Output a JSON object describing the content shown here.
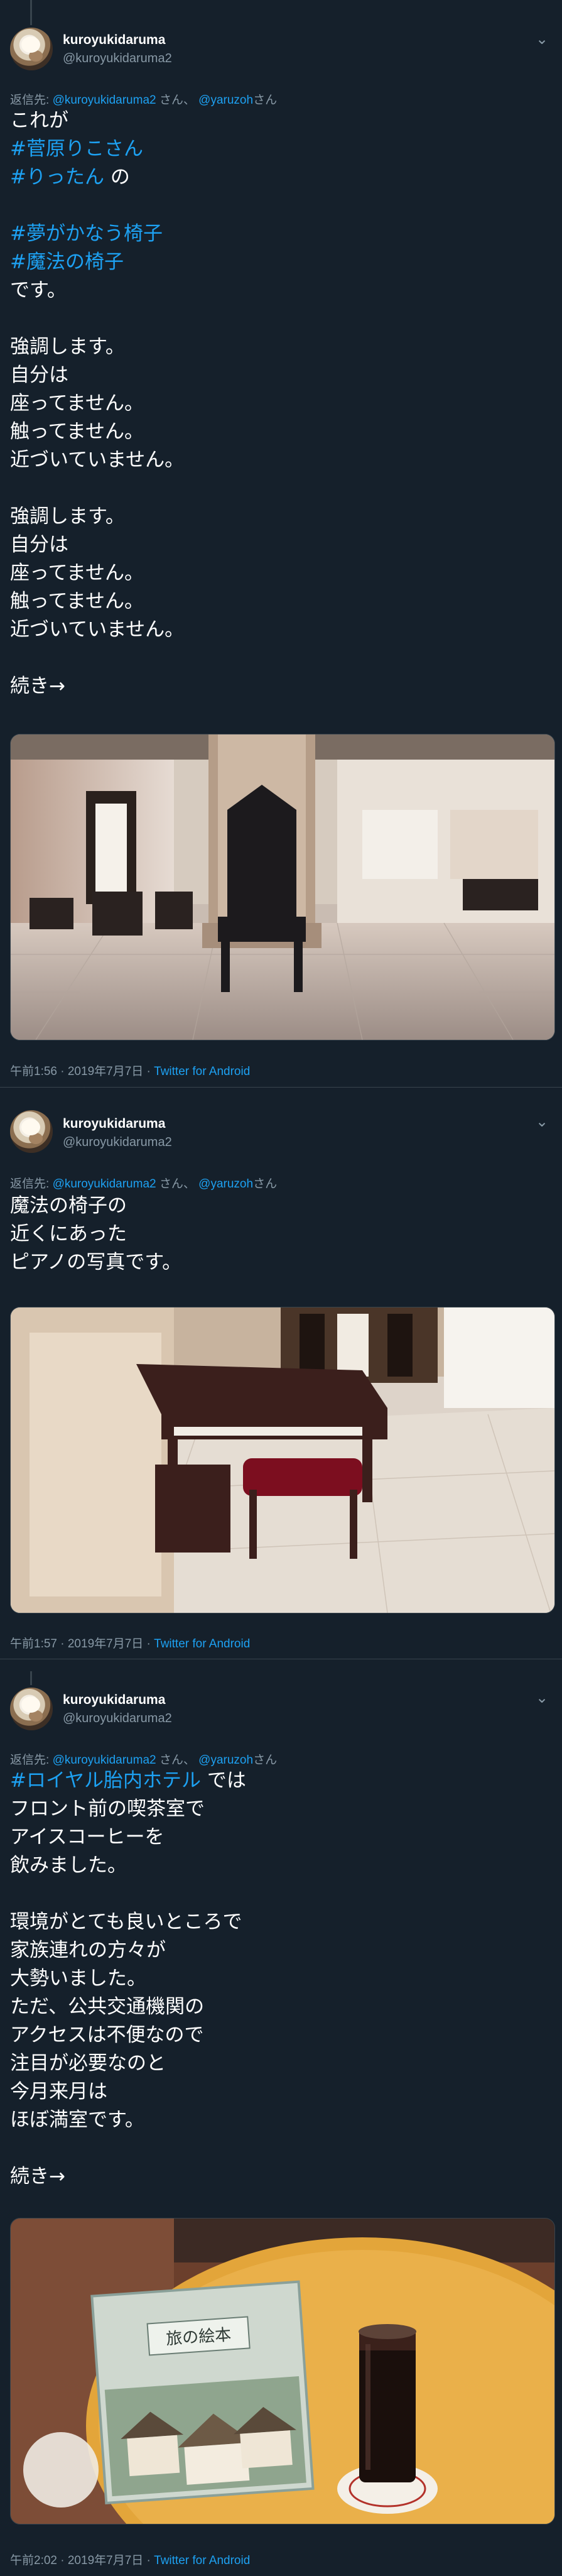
{
  "tweets": [
    {
      "display_name": "kuroyukidaruma",
      "handle": "@kuroyukidaruma2",
      "reply_prefix": "返信先:",
      "reply_mention_1": "@kuroyukidaruma2",
      "reply_suffix_1": "さん、",
      "reply_mention_2": "@yaruzoh",
      "reply_suffix_2": "さん",
      "lines": [
        {
          "parts": [
            {
              "text": "これが",
              "tag": false
            }
          ]
        },
        {
          "parts": [
            {
              "text": "#菅原りこさん",
              "tag": true
            }
          ]
        },
        {
          "parts": [
            {
              "text": "#りったん",
              "tag": true
            },
            {
              "text": " の",
              "tag": false
            }
          ]
        },
        {
          "parts": []
        },
        {
          "parts": [
            {
              "text": "#夢がかなう椅子",
              "tag": true
            }
          ]
        },
        {
          "parts": [
            {
              "text": "#魔法の椅子",
              "tag": true
            }
          ]
        },
        {
          "parts": [
            {
              "text": "です。",
              "tag": false
            }
          ]
        },
        {
          "parts": []
        },
        {
          "parts": [
            {
              "text": "強調します。",
              "tag": false
            }
          ]
        },
        {
          "parts": [
            {
              "text": "自分は",
              "tag": false
            }
          ]
        },
        {
          "parts": [
            {
              "text": "座ってません。",
              "tag": false
            }
          ]
        },
        {
          "parts": [
            {
              "text": "触ってません。",
              "tag": false
            }
          ]
        },
        {
          "parts": [
            {
              "text": "近づいていません。",
              "tag": false
            }
          ]
        },
        {
          "parts": []
        },
        {
          "parts": [
            {
              "text": "強調します。",
              "tag": false
            }
          ]
        },
        {
          "parts": [
            {
              "text": "自分は",
              "tag": false
            }
          ]
        },
        {
          "parts": [
            {
              "text": "座ってません。",
              "tag": false
            }
          ]
        },
        {
          "parts": [
            {
              "text": "触ってません。",
              "tag": false
            }
          ]
        },
        {
          "parts": [
            {
              "text": "近づいていません。",
              "tag": false
            }
          ]
        },
        {
          "parts": []
        },
        {
          "parts": [
            {
              "text": "続き→",
              "tag": false
            }
          ]
        }
      ],
      "timestamp": "午前1:56 · 2019年7月7日 · ",
      "source": "Twitter for Android"
    },
    {
      "display_name": "kuroyukidaruma",
      "handle": "@kuroyukidaruma2",
      "reply_prefix": "返信先:",
      "reply_mention_1": "@kuroyukidaruma2",
      "reply_suffix_1": "さん、",
      "reply_mention_2": "@yaruzoh",
      "reply_suffix_2": "さん",
      "lines": [
        {
          "parts": [
            {
              "text": "魔法の椅子の",
              "tag": false
            }
          ]
        },
        {
          "parts": [
            {
              "text": "近くにあった",
              "tag": false
            }
          ]
        },
        {
          "parts": [
            {
              "text": "ピアノの写真です。",
              "tag": false
            }
          ]
        }
      ],
      "timestamp": "午前1:57 · 2019年7月7日 · ",
      "source": "Twitter for Android"
    },
    {
      "display_name": "kuroyukidaruma",
      "handle": "@kuroyukidaruma2",
      "reply_prefix": "返信先:",
      "reply_mention_1": "@kuroyukidaruma2",
      "reply_suffix_1": "さん、",
      "reply_mention_2": "@yaruzoh",
      "reply_suffix_2": "さん",
      "lines": [
        {
          "parts": [
            {
              "text": "#ロイヤル胎内ホテル",
              "tag": true
            },
            {
              "text": " では",
              "tag": false
            }
          ]
        },
        {
          "parts": [
            {
              "text": "フロント前の喫茶室で",
              "tag": false
            }
          ]
        },
        {
          "parts": [
            {
              "text": "アイスコーヒーを",
              "tag": false
            }
          ]
        },
        {
          "parts": [
            {
              "text": "飲みました。",
              "tag": false
            }
          ]
        },
        {
          "parts": []
        },
        {
          "parts": [
            {
              "text": "環境がとても良いところで",
              "tag": false
            }
          ]
        },
        {
          "parts": [
            {
              "text": "家族連れの方々が",
              "tag": false
            }
          ]
        },
        {
          "parts": [
            {
              "text": "大勢いました。",
              "tag": false
            }
          ]
        },
        {
          "parts": [
            {
              "text": "ただ、公共交通機関の",
              "tag": false
            }
          ]
        },
        {
          "parts": [
            {
              "text": "アクセスは不便なので",
              "tag": false
            }
          ]
        },
        {
          "parts": [
            {
              "text": "注目が必要なのと",
              "tag": false
            }
          ]
        },
        {
          "parts": [
            {
              "text": "今月来月は",
              "tag": false
            }
          ]
        },
        {
          "parts": [
            {
              "text": "ほぼ満室です。",
              "tag": false
            }
          ]
        },
        {
          "parts": []
        },
        {
          "parts": [
            {
              "text": "続き→",
              "tag": false
            }
          ]
        }
      ],
      "timestamp": "午前2:02 · 2019年7月7日 · ",
      "source": "Twitter for Android",
      "book_title": "旅の絵本"
    }
  ],
  "icons": {
    "more": "chevron-down-icon"
  },
  "colors": {
    "background": "#15202b",
    "accent": "#1da1f2",
    "muted": "#8899a6",
    "border": "#38444d"
  }
}
